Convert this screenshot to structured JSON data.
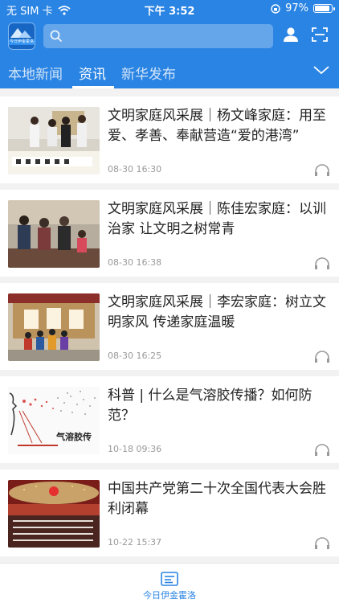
{
  "status_bar": {
    "carrier": "无 SIM 卡",
    "time": "下午 3:52",
    "battery": "97%",
    "battery_level": 0.97
  },
  "header": {
    "logo_text": "今日伊金霍洛",
    "search": {
      "placeholder": ""
    },
    "tabs": [
      {
        "label": "本地新闻",
        "active": false
      },
      {
        "label": "资讯",
        "active": true
      },
      {
        "label": "新华发布",
        "active": false
      }
    ]
  },
  "feed": {
    "items": [
      {
        "title": "文明家庭风采展｜杨文峰家庭：用至爱、孝善、奉献营造“爱的港湾”",
        "time": "08-30 16:30",
        "thumb": "family-calligraphy"
      },
      {
        "title": "文明家庭风采展｜陈佳宏家庭：以训治家 让文明之树常青",
        "time": "08-30 16:38",
        "thumb": "family-portrait"
      },
      {
        "title": "文明家庭风采展｜李宏家庭：树立文明家风 传递家庭温暖",
        "time": "08-30 16:25",
        "thumb": "family-gate"
      },
      {
        "title": "科普 | 什么是气溶胶传播？如何防范？",
        "time": "10-18 09:36",
        "thumb": "aerosol-diagram",
        "thumb_text": "气溶胶传"
      },
      {
        "title": "中国共产党第二十次全国代表大会胜利闭幕",
        "time": "10-22 15:37",
        "thumb": "congress-hall"
      }
    ]
  },
  "tabbar": {
    "label": "今日伊金霍洛"
  },
  "colors": {
    "brand": "#2a84e3",
    "title_text": "#222222",
    "time_text": "#999999"
  }
}
